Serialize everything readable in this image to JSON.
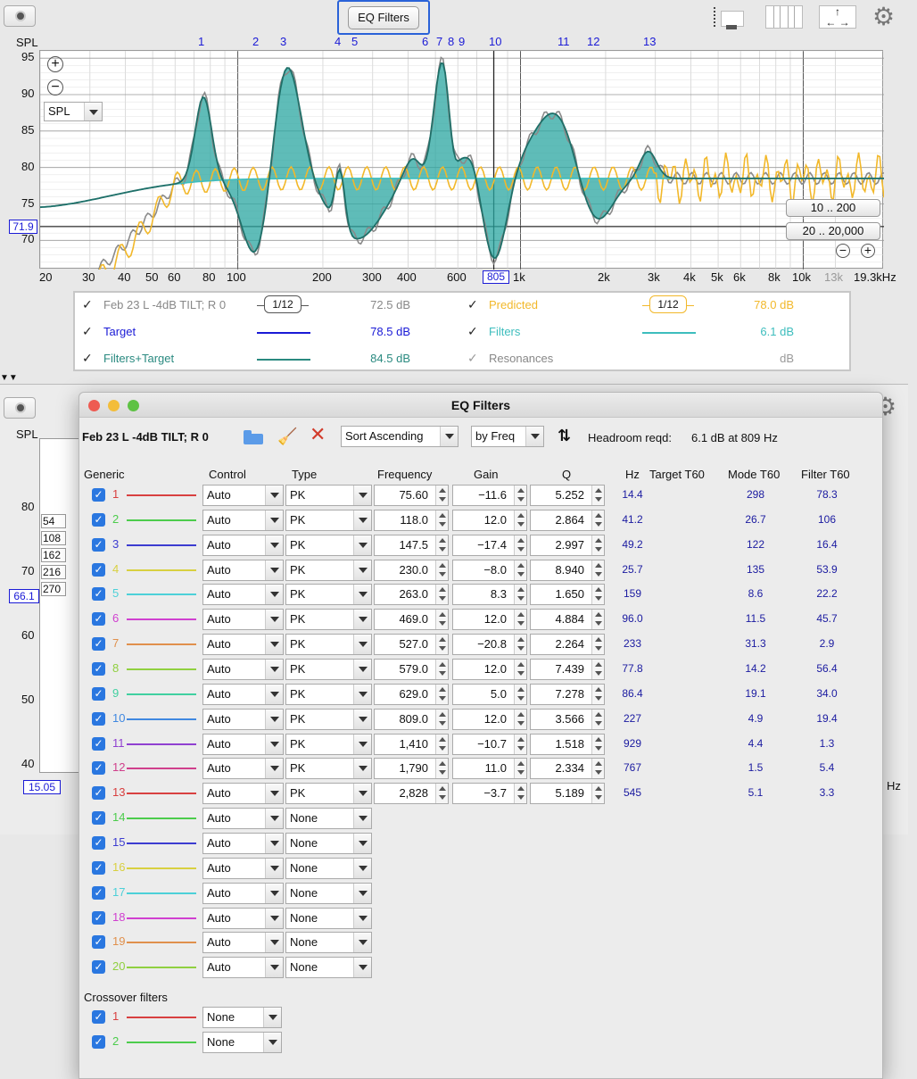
{
  "toolbar": {
    "eq_filters_label": "EQ Filters"
  },
  "top_chart": {
    "spl_label": "SPL",
    "spl_select": "SPL",
    "y_ticks": [
      "95",
      "90",
      "85",
      "80",
      "75",
      "70"
    ],
    "cursor_readout": "71.9",
    "x_ticks": [
      "20",
      "30",
      "40",
      "50",
      "60",
      "80",
      "100",
      "200",
      "300",
      "400",
      "600",
      "1k",
      "2k",
      "3k",
      "4k",
      "5k",
      "6k",
      "8k",
      "10k",
      "13k",
      "19.3kHz"
    ],
    "x_cursor": "805",
    "filter_markers": [
      "1",
      "2",
      "3",
      "4",
      "5",
      "6",
      "7",
      "8",
      "9",
      "10",
      "11",
      "12",
      "13"
    ],
    "range_btn_1": "10 .. 200",
    "range_btn_2": "20 .. 20,000"
  },
  "legend": [
    {
      "name": "Feb 23 L -4dB TILT; R 0",
      "smoothing": "1/12",
      "value": "72.5 dB",
      "color": "#888888"
    },
    {
      "name": "Predicted",
      "smoothing": "1/12",
      "value": "78.0 dB",
      "color": "#f2b82a"
    },
    {
      "name": "Target",
      "value": "78.5 dB",
      "color": "#1a1ad6"
    },
    {
      "name": "Filters",
      "value": "6.1 dB",
      "color": "#3dbdbd"
    },
    {
      "name": "Filters+Target",
      "value": "84.5 dB",
      "color": "#2a8a80"
    },
    {
      "name": "Resonances",
      "value": "dB",
      "color": "#888888"
    }
  ],
  "lower_panel": {
    "spl_label": "SPL",
    "y_ticks": [
      "80",
      "70",
      "60",
      "50",
      "40"
    ],
    "cursor_readout": "66.1",
    "x_readout": "15.05",
    "small_boxes": [
      "54",
      "108",
      "162",
      "216",
      "270"
    ],
    "hz_label": "Hz"
  },
  "dialog": {
    "title": "EQ Filters",
    "measurement": "Feb 23 L -4dB TILT; R 0",
    "sort_select": "Sort Ascending",
    "by_select": "by Freq",
    "headroom_label": "Headroom reqd:",
    "headroom_value": "6.1 dB at 809 Hz",
    "headers": {
      "generic": "Generic",
      "control": "Control",
      "type": "Type",
      "frequency": "Frequency",
      "gain": "Gain",
      "q": "Q",
      "hz": "Hz",
      "target_t60": "Target T60",
      "mode_t60": "Mode T60",
      "filter_t60": "Filter T60"
    },
    "filters": [
      {
        "n": "1",
        "color": "#d84040",
        "control": "Auto",
        "type": "PK",
        "freq": "75.60",
        "gain": "-11.6",
        "q": "5.252",
        "hz": "14.4",
        "mode": "298",
        "filt": "78.3"
      },
      {
        "n": "2",
        "color": "#4ccc4c",
        "control": "Auto",
        "type": "PK",
        "freq": "118.0",
        "gain": "12.0",
        "q": "2.864",
        "hz": "41.2",
        "mode": "26.7",
        "filt": "106"
      },
      {
        "n": "3",
        "color": "#3c3cd0",
        "control": "Auto",
        "type": "PK",
        "freq": "147.5",
        "gain": "-17.4",
        "q": "2.997",
        "hz": "49.2",
        "mode": "122",
        "filt": "16.4"
      },
      {
        "n": "4",
        "color": "#d8d040",
        "control": "Auto",
        "type": "PK",
        "freq": "230.0",
        "gain": "-8.0",
        "q": "8.940",
        "hz": "25.7",
        "mode": "135",
        "filt": "53.9"
      },
      {
        "n": "5",
        "color": "#4cd0d8",
        "control": "Auto",
        "type": "PK",
        "freq": "263.0",
        "gain": "8.3",
        "q": "1.650",
        "hz": "159",
        "mode": "8.6",
        "filt": "22.2"
      },
      {
        "n": "6",
        "color": "#d040d0",
        "control": "Auto",
        "type": "PK",
        "freq": "469.0",
        "gain": "12.0",
        "q": "4.884",
        "hz": "96.0",
        "mode": "11.5",
        "filt": "45.7"
      },
      {
        "n": "7",
        "color": "#e0904c",
        "control": "Auto",
        "type": "PK",
        "freq": "527.0",
        "gain": "-20.8",
        "q": "2.264",
        "hz": "233",
        "mode": "31.3",
        "filt": "2.9"
      },
      {
        "n": "8",
        "color": "#90d040",
        "control": "Auto",
        "type": "PK",
        "freq": "579.0",
        "gain": "12.0",
        "q": "7.439",
        "hz": "77.8",
        "mode": "14.2",
        "filt": "56.4"
      },
      {
        "n": "9",
        "color": "#40d0a0",
        "control": "Auto",
        "type": "PK",
        "freq": "629.0",
        "gain": "5.0",
        "q": "7.278",
        "hz": "86.4",
        "mode": "19.1",
        "filt": "34.0"
      },
      {
        "n": "10",
        "color": "#4088e0",
        "control": "Auto",
        "type": "PK",
        "freq": "809.0",
        "gain": "12.0",
        "q": "3.566",
        "hz": "227",
        "mode": "4.9",
        "filt": "19.4"
      },
      {
        "n": "11",
        "color": "#9040d0",
        "control": "Auto",
        "type": "PK",
        "freq": "1,410",
        "gain": "-10.7",
        "q": "1.518",
        "hz": "929",
        "mode": "4.4",
        "filt": "1.3"
      },
      {
        "n": "12",
        "color": "#d0408c",
        "control": "Auto",
        "type": "PK",
        "freq": "1,790",
        "gain": "11.0",
        "q": "2.334",
        "hz": "767",
        "mode": "1.5",
        "filt": "5.4"
      },
      {
        "n": "13",
        "color": "#d84040",
        "control": "Auto",
        "type": "PK",
        "freq": "2,828",
        "gain": "-3.7",
        "q": "5.189",
        "hz": "545",
        "mode": "5.1",
        "filt": "3.3"
      },
      {
        "n": "14",
        "color": "#4ccc4c",
        "control": "Auto",
        "type": "None"
      },
      {
        "n": "15",
        "color": "#3c3cd0",
        "control": "Auto",
        "type": "None"
      },
      {
        "n": "16",
        "color": "#d8d040",
        "control": "Auto",
        "type": "None"
      },
      {
        "n": "17",
        "color": "#4cd0d8",
        "control": "Auto",
        "type": "None"
      },
      {
        "n": "18",
        "color": "#d040d0",
        "control": "Auto",
        "type": "None"
      },
      {
        "n": "19",
        "color": "#e0904c",
        "control": "Auto",
        "type": "None"
      },
      {
        "n": "20",
        "color": "#90d040",
        "control": "Auto",
        "type": "None"
      }
    ],
    "crossover_title": "Crossover filters",
    "crossovers": [
      {
        "n": "1",
        "color": "#d84040",
        "type": "None"
      },
      {
        "n": "2",
        "color": "#4ccc4c",
        "type": "None"
      }
    ]
  }
}
